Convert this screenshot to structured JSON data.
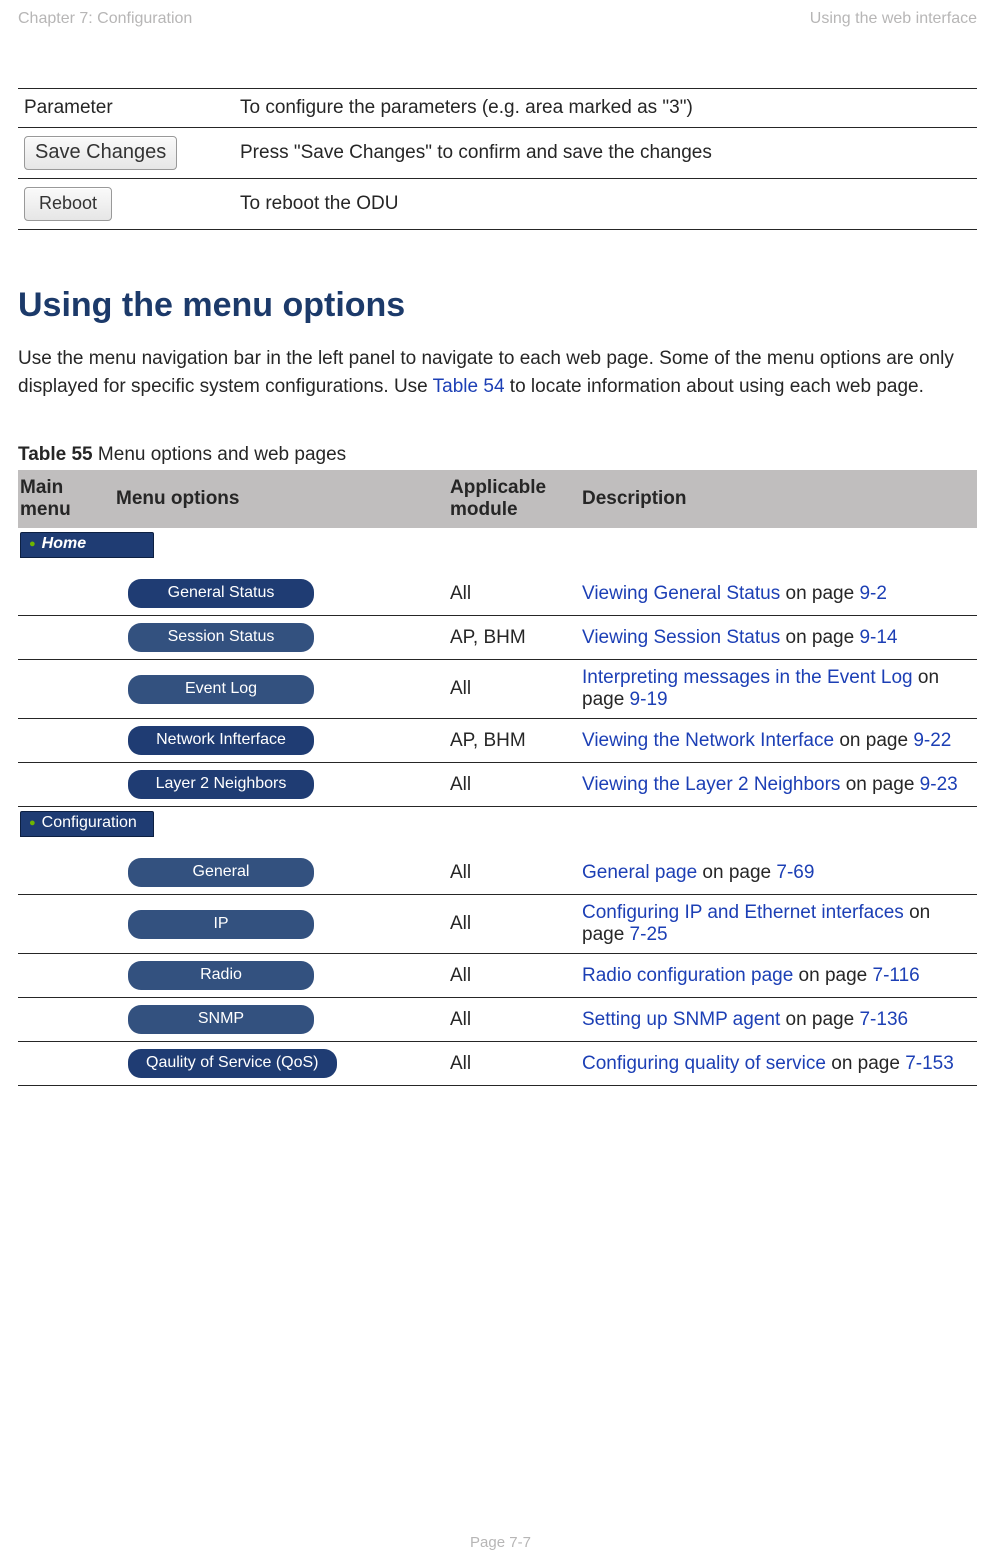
{
  "header": {
    "chapter": "Chapter 7:  Configuration",
    "section": "Using the web interface"
  },
  "top_table": {
    "rows": [
      {
        "label_type": "text",
        "label": "Parameter",
        "desc": "To configure the parameters (e.g. area marked as \"3\")"
      },
      {
        "label_type": "button",
        "label": "Save Changes",
        "desc": "Press \"Save Changes\" to confirm and save the changes"
      },
      {
        "label_type": "button",
        "label": "Reboot",
        "desc": "To reboot the ODU"
      }
    ]
  },
  "heading": "Using the menu options",
  "intro": {
    "pre": "Use the menu navigation bar in the left panel to navigate to each web page. Some of the menu options are only displayed for specific system configurations. Use ",
    "link": "Table 54",
    "post": " to locate information about using each web page."
  },
  "table_caption": {
    "bold": "Table 55",
    "rest": "  Menu options and web pages"
  },
  "menu_table": {
    "headers": {
      "main": "Main menu",
      "opt": "Menu options",
      "mod": "Applicable module",
      "desc": "Description"
    },
    "groups": [
      {
        "nav": "Home",
        "nav_class": "home",
        "rows": [
          {
            "pill": "General Status",
            "pill_muted": false,
            "module": "All",
            "desc_link": "Viewing General Status",
            "desc_mid": " on page ",
            "page": "9-2"
          },
          {
            "pill": "Session Status",
            "pill_muted": true,
            "module": "AP, BHM",
            "desc_link": "Viewing Session Status",
            "desc_mid": " on page ",
            "page": "9-14"
          },
          {
            "pill": "Event Log",
            "pill_muted": true,
            "module": "All",
            "desc_link": "Interpreting messages in the Event Log",
            "desc_mid": " on page ",
            "page": "9-19"
          },
          {
            "pill": "Network Infterface",
            "pill_muted": false,
            "module": "AP, BHM",
            "desc_link": "Viewing the Network Interface",
            "desc_mid": " on page ",
            "page": "9-22"
          },
          {
            "pill": "Layer 2 Neighbors",
            "pill_muted": false,
            "module": "All",
            "desc_link": "Viewing the Layer 2 Neighbors",
            "desc_mid": " on page ",
            "page": "9-23"
          }
        ]
      },
      {
        "nav": "Configuration",
        "nav_class": "config",
        "rows": [
          {
            "pill": "General",
            "pill_muted": true,
            "module": "All",
            "desc_link": "General page",
            "desc_mid": " on page ",
            "page": "7-69"
          },
          {
            "pill": "IP",
            "pill_muted": true,
            "module": "All",
            "desc_link": "Configuring IP and Ethernet interfaces",
            "desc_mid": " on page ",
            "page": "7-25"
          },
          {
            "pill": "Radio",
            "pill_muted": true,
            "module": "All",
            "desc_link": "Radio configuration page",
            "desc_mid": " on page ",
            "page": "7-116"
          },
          {
            "pill": "SNMP",
            "pill_muted": true,
            "module": "All",
            "desc_link": "Setting up SNMP agent",
            "desc_mid": " on page ",
            "page": "7-136"
          },
          {
            "pill": "Qaulity of Service (QoS)",
            "pill_muted": false,
            "module": "All",
            "desc_link": "Configuring quality of service",
            "desc_mid": " on page ",
            "page": "7-153"
          }
        ]
      }
    ]
  },
  "footer": "Page 7-7"
}
